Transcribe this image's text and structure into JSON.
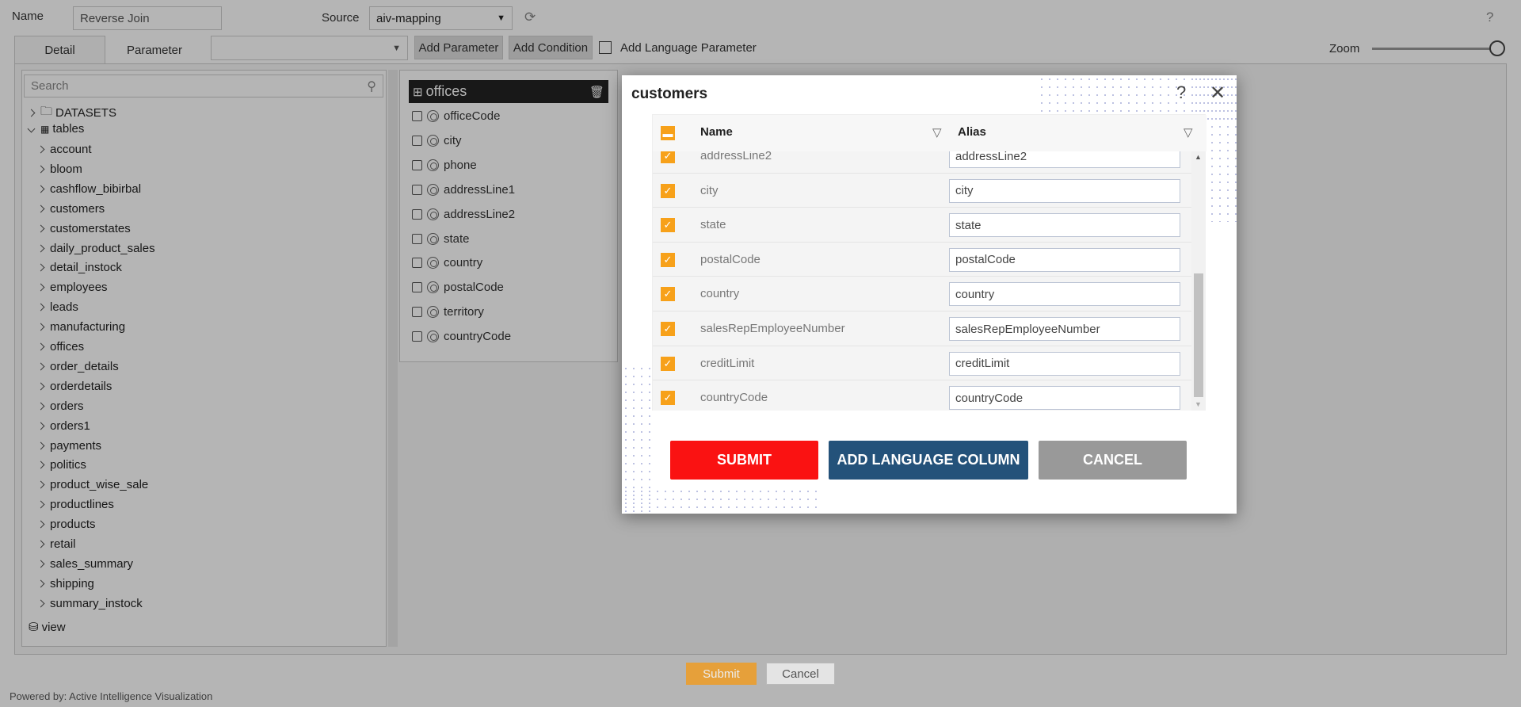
{
  "header": {
    "name_label": "Name",
    "name_value": "Reverse Join",
    "source_label": "Source",
    "source_value": "aiv-mapping",
    "help": "?"
  },
  "toolbar": {
    "tab_detail": "Detail",
    "tab_parameter": "Parameter",
    "parameter_select": "",
    "add_parameter": "Add Parameter",
    "add_condition": "Add Condition",
    "add_language_parameter": "Add Language Parameter",
    "zoom_label": "Zoom",
    "zoom_level": 1.0
  },
  "tree": {
    "search_placeholder": "Search",
    "datasets": "DATASETS",
    "tables": "tables",
    "items": [
      "account",
      "bloom",
      "cashflow_bibirbal",
      "customers",
      "customerstates",
      "daily_product_sales",
      "detail_instock",
      "employees",
      "leads",
      "manufacturing",
      "offices",
      "order_details",
      "orderdetails",
      "orders",
      "orders1",
      "payments",
      "politics",
      "product_wise_sale",
      "productlines",
      "products",
      "retail",
      "sales_summary",
      "shipping",
      "summary_instock"
    ],
    "view": "view"
  },
  "table_card": {
    "title": "offices",
    "fields": [
      "officeCode",
      "city",
      "phone",
      "addressLine1",
      "addressLine2",
      "state",
      "country",
      "postalCode",
      "territory",
      "countryCode"
    ]
  },
  "modal": {
    "title": "customers",
    "help": "?",
    "col_name": "Name",
    "col_alias": "Alias",
    "rows": [
      {
        "name": "addressLine2",
        "alias": "addressLine2"
      },
      {
        "name": "city",
        "alias": "city"
      },
      {
        "name": "state",
        "alias": "state"
      },
      {
        "name": "postalCode",
        "alias": "postalCode"
      },
      {
        "name": "country",
        "alias": "country"
      },
      {
        "name": "salesRepEmployeeNumber",
        "alias": "salesRepEmployeeNumber"
      },
      {
        "name": "creditLimit",
        "alias": "creditLimit"
      },
      {
        "name": "countryCode",
        "alias": "countryCode"
      }
    ],
    "submit": "SUBMIT",
    "add_language_column": "ADD LANGUAGE COLUMN",
    "cancel": "CANCEL"
  },
  "footer": {
    "submit": "Submit",
    "cancel": "Cancel",
    "powered_by": "Powered by: Active Intelligence Visualization"
  },
  "colors": {
    "accent": "#f7a11a",
    "submit_red": "#fa1212",
    "language_blue": "#24527a",
    "cancel_grey": "#999999",
    "footer_submit": "#f79a12"
  }
}
